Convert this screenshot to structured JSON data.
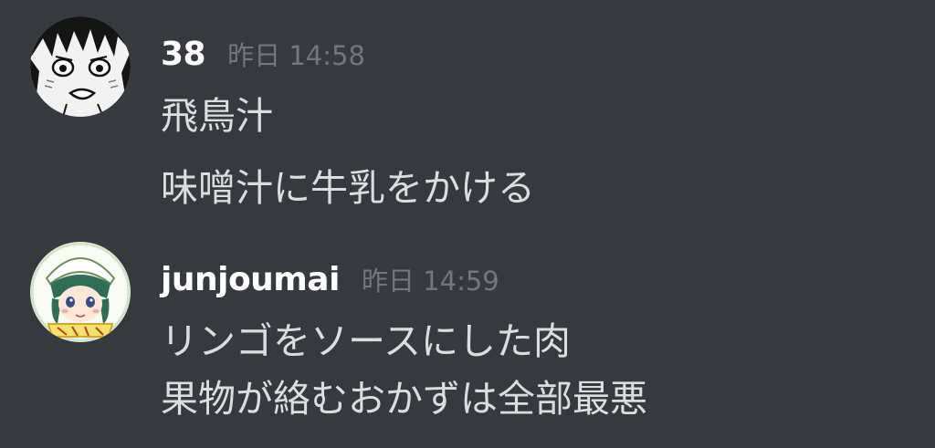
{
  "messages": [
    {
      "username": "38",
      "timestamp": "昨日 14:58",
      "avatar": "manga-character-avatar",
      "lines": [
        "飛鳥汁",
        "味噌汁に牛乳をかける"
      ]
    },
    {
      "username": "junjoumai",
      "timestamp": "昨日 14:59",
      "avatar": "anime-girl-avatar",
      "lines": [
        "リンゴをソースにした肉",
        "果物が絡むおかずは全部最悪"
      ]
    }
  ],
  "colors": {
    "background": "#36393f",
    "username": "#ffffff",
    "timestamp": "#72767d",
    "message_text": "#dcddde"
  }
}
